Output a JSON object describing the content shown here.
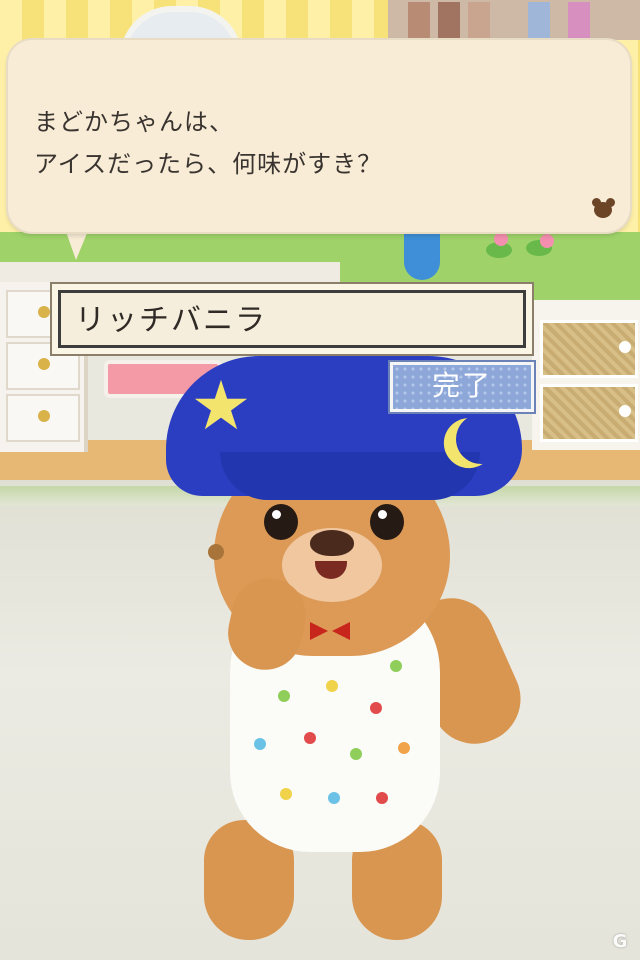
{
  "dialog": {
    "line1": "まどかちゃんは、",
    "line2": "アイスだったら、何味がすき？",
    "corner_icon": "bear-head-icon"
  },
  "answer_input": {
    "value": "リッチバニラ"
  },
  "done_button": {
    "label": "完了"
  },
  "character": {
    "hat_icons": [
      "star-icon",
      "moon-icon"
    ]
  },
  "watermark": {
    "text": "G"
  },
  "colors": {
    "bubble": "#f8ecd6",
    "done_button": "#8da7d8",
    "hat": "#2b3ec2"
  }
}
